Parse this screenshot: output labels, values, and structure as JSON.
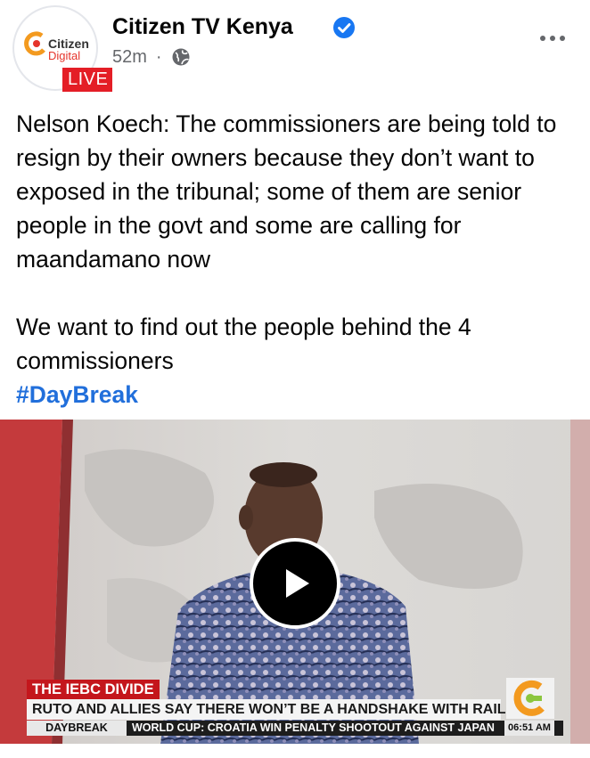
{
  "page": {
    "name": "Citizen TV Kenya",
    "verified_icon": "verified-check-icon",
    "time": "52m",
    "separator": "·",
    "privacy_icon": "globe-icon",
    "more_icon": "more-options-icon"
  },
  "avatar": {
    "logo_text": "Citizen",
    "logo_sub": "Digital",
    "live_label": "LIVE"
  },
  "post": {
    "paragraph1": "Nelson Koech: The commissioners are being told to resign by their owners because they don’t want to exposed in the tribunal; some of them are senior people in the govt and some are calling for maandamano now",
    "paragraph2": "We want to find out the people behind the 4 commissioners",
    "hashtag": "#DayBreak"
  },
  "video": {
    "play_icon": "play-icon",
    "strap_title": "THE IEBC DIVIDE",
    "strap_headline": "RUTO AND ALLIES SAY THERE WON’T BE A HANDSHAKE WITH RAILA",
    "show_name": "DAYBREAK",
    "ticker": "WORLD CUP: CROATIA WIN PENALTY SHOOTOUT AGAINST JAPAN",
    "clock": "06:51 AM",
    "colors": {
      "strap_red": "#c4161c",
      "logo_orange": "#f39a1f",
      "logo_green": "#8cc63f"
    }
  }
}
